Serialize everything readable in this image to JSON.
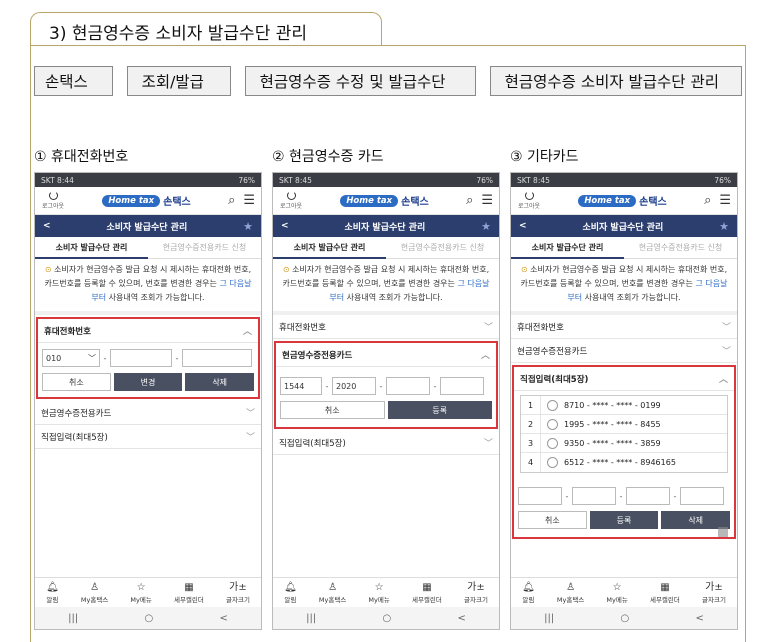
{
  "section_title": "3) 현금영수증 소비자 발급수단 관리",
  "breadcrumb": [
    "손택스",
    "조회/발급",
    "현금영수증 수정 및 발급수단",
    "현금영수증 소비자 발급수단 관리"
  ],
  "panels": [
    {
      "label": "① 휴대전화번호",
      "time": "SKT 8:44"
    },
    {
      "label": "② 현금영수증 카드",
      "time": "SKT 8:45"
    },
    {
      "label": "③ 기타카드",
      "time": "SKT 8:45"
    }
  ],
  "status_right": "76%",
  "app": {
    "logout": "로그아웃",
    "brand_home": "Home tax",
    "brand_name": "손택스",
    "page_title": "소비자 발급수단 관리",
    "tab1": "소비자 발급수단 관리",
    "tab2": "현금영수증전용카드 신청",
    "notice_pre": "소비자가 현금영수증 발급 요청 시 제시하는 휴대전화 번호, 카드번호를 등록할 수 있으며, 번호를 변경한 경우는 ",
    "notice_hl": "그 다음날부터",
    "notice_post": " 사용내역 조회가 가능합니다.",
    "acc_phone": "휴대전화번호",
    "acc_card": "현금영수증전용카드",
    "acc_direct": "직접입력(최대5장)"
  },
  "phone_form": {
    "prefix": "010",
    "btn_cancel": "취소",
    "btn_change": "변경",
    "btn_delete": "삭제"
  },
  "card_form": {
    "part1": "1544",
    "part2": "2020",
    "btn_cancel": "취소",
    "btn_register": "등록"
  },
  "direct_list": [
    {
      "num": "1",
      "card": "8710 - **** - **** - 0199"
    },
    {
      "num": "2",
      "card": "1995 - **** - **** - 8455"
    },
    {
      "num": "3",
      "card": "9350 - **** - **** - 3859"
    },
    {
      "num": "4",
      "card": "6512 - **** - **** - 8946165"
    }
  ],
  "direct_form": {
    "btn_cancel": "취소",
    "btn_register": "등록",
    "btn_delete": "삭제"
  },
  "bottom_nav": [
    "알림",
    "My홈택스",
    "My메뉴",
    "세무캘린더",
    "글자크기"
  ],
  "bottom_icons": [
    "bell-icon",
    "person-icon",
    "star-icon",
    "calendar-icon",
    "text-size-icon"
  ],
  "text_size_glyph": "가±",
  "colors": {
    "navbar": "#2c3e6e",
    "highlight": "#d9363e",
    "frame": "#b9a56a"
  }
}
